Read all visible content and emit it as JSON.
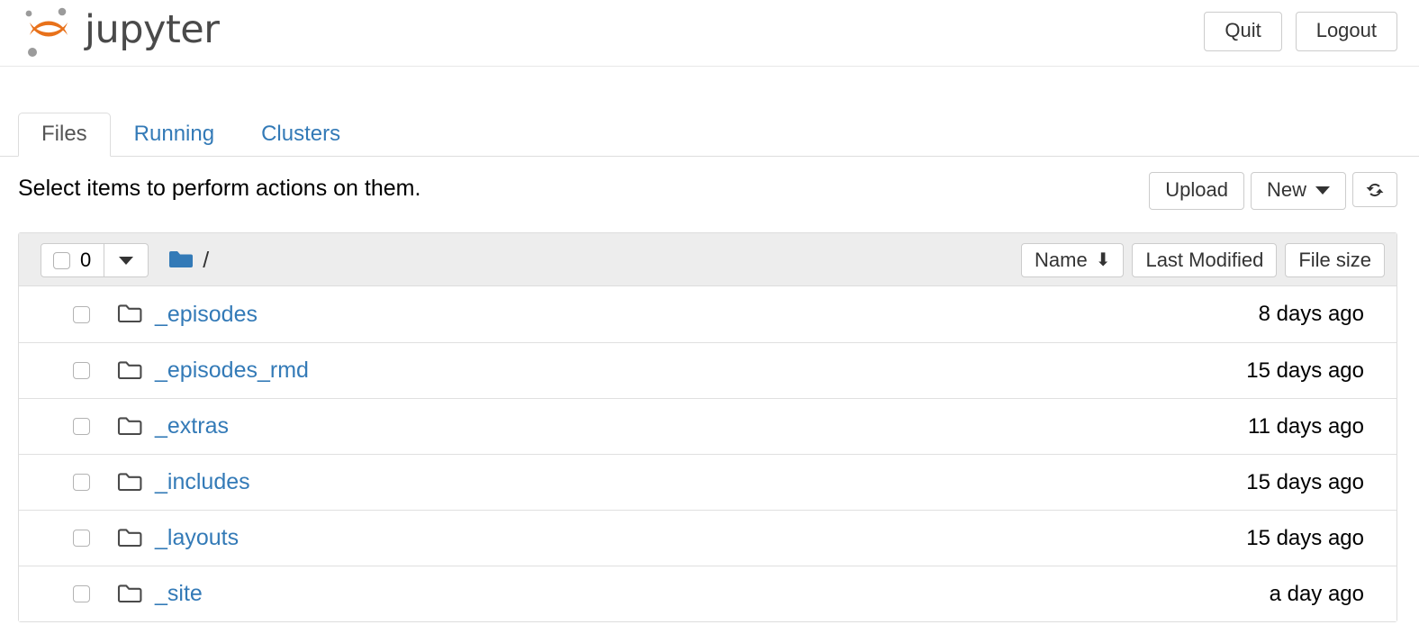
{
  "header": {
    "brand_text": "jupyter",
    "logo_icon": "jupyter-logo",
    "quit_label": "Quit",
    "logout_label": "Logout"
  },
  "tabs": [
    {
      "label": "Files",
      "active": true
    },
    {
      "label": "Running",
      "active": false
    },
    {
      "label": "Clusters",
      "active": false
    }
  ],
  "toolbar": {
    "alert_text": "Select items to perform actions on them.",
    "upload_label": "Upload",
    "new_label": "New",
    "new_caret_icon": "chevron-down-icon",
    "refresh_icon": "refresh-icon"
  },
  "list_header": {
    "select_all_checkbox": "unchecked",
    "selected_count": "0",
    "dropdown_caret_icon": "chevron-down-icon",
    "breadcrumb_folder_icon": "folder-filled-icon",
    "breadcrumb_path": "/",
    "sort_name_label": "Name",
    "sort_name_arrow": "⬇",
    "sort_modified_label": "Last Modified",
    "sort_size_label": "File size"
  },
  "files": [
    {
      "name": "_episodes",
      "icon": "folder-icon",
      "modified": "8 days ago"
    },
    {
      "name": "_episodes_rmd",
      "icon": "folder-icon",
      "modified": "15 days ago"
    },
    {
      "name": "_extras",
      "icon": "folder-icon",
      "modified": "11 days ago"
    },
    {
      "name": "_includes",
      "icon": "folder-icon",
      "modified": "15 days ago"
    },
    {
      "name": "_layouts",
      "icon": "folder-icon",
      "modified": "15 days ago"
    },
    {
      "name": "_site",
      "icon": "folder-icon",
      "modified": "a day ago"
    }
  ],
  "colors": {
    "link_blue": "#337ab7",
    "logo_orange": "#e8711a",
    "logo_gray": "#9b9b9b",
    "header_gray": "#ededed",
    "border_gray": "#dddddd",
    "text_dark": "#333333"
  }
}
